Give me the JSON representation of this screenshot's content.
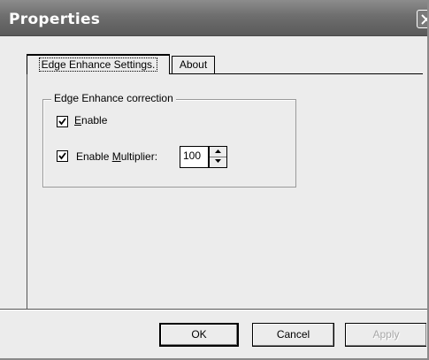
{
  "window": {
    "title": "Properties",
    "close_icon": "close-icon"
  },
  "tabs": [
    {
      "label": "Edge Enhance Settings.",
      "active": true
    },
    {
      "label": "About",
      "active": false
    }
  ],
  "group": {
    "title": "Edge Enhance correction",
    "enable": {
      "checked": true,
      "label_mnemonic": "E",
      "label_rest": "nable"
    },
    "multiplier": {
      "checked": true,
      "label_prefix": "Enable ",
      "label_mnemonic": "M",
      "label_rest": "ultiplier:",
      "value": "100"
    }
  },
  "buttons": {
    "ok": "OK",
    "cancel": "Cancel",
    "apply": "Apply"
  },
  "colors": {
    "titlebar": "#6e6e6e",
    "face": "#ececec",
    "disabled_text": "#a8a8a8"
  }
}
